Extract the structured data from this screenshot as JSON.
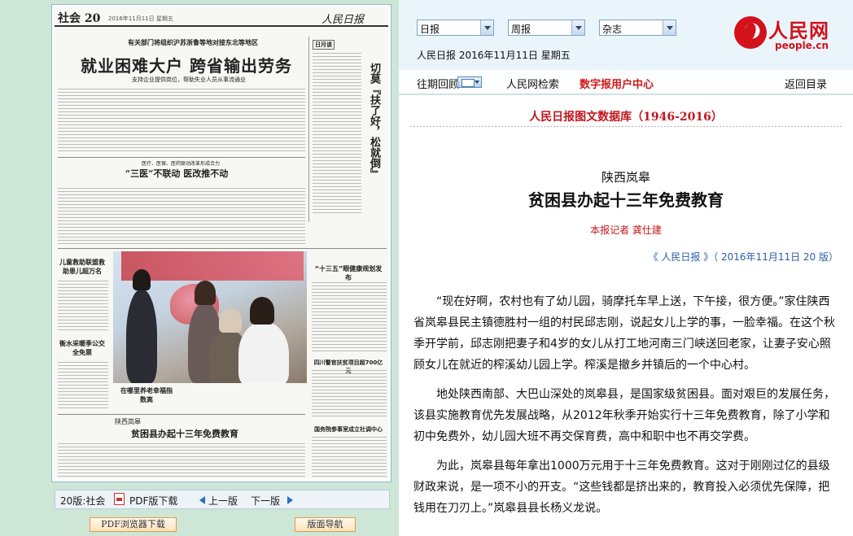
{
  "paper": {
    "section": "社会 20",
    "date": "2016年11月11日 星期五",
    "logo": "人民日报",
    "kicker": "有关部门将组织沪苏浙鲁等地对接东北等地区",
    "headline": "就业困难大户  跨省输出劳务",
    "deck": "支持企业提供岗位，帮助失业人员从事流通业",
    "side_title": "日月谈",
    "side_vertical": "切莫『扶了好，松就倒』",
    "sub_sanyi_kicker": "医疗、医保、医药联动改革形成合力",
    "sub_sanyi": "“三医”不联动  医改推不动",
    "sub_children": "儿童救助联盟救助患儿超万名",
    "sub_winter": "衡水采暖季公交全免票",
    "sub_plan": "“十三五”眼健康规划发布",
    "sub_photo_caption": "在哪里养老幸福指数高",
    "sub_fund": "四川警官扶贫项目超700亿元",
    "sub_region": "陕西岚皋",
    "sub_article": "贫困县办起十三年免费教育",
    "sub_state": "国务院参事室成立社调中心"
  },
  "page_bar": {
    "section": "20版:社会",
    "pdf": "PDF版下载",
    "prev": "上一版",
    "next": "下一版"
  },
  "buttons": {
    "pdf_browser": "PDF浏览器下载",
    "layout_nav": "版面导航"
  },
  "header": {
    "selects": [
      "日报",
      "周报",
      "杂志"
    ],
    "issue_date": "人民日报  2016年11月11日  星期五",
    "logo_cn": "人民网",
    "logo_en": "people.cn"
  },
  "nav": {
    "back_issues": "往期回顾",
    "search": "人民网检索",
    "user_center": "数字报用户中心",
    "return": "返回目录"
  },
  "article": {
    "db_title": "人民日报图文数据库（1946-2016）",
    "pre_title": "陕西岚皋",
    "title": "贫困县办起十三年免费教育",
    "byline": "本报记者  龚仕建",
    "source": "《 人民日报 》（ 2016年11月11日   20 版）",
    "paragraphs": [
      "“现在好啊，农村也有了幼儿园，骑摩托车早上送，下午接，很方便。”家住陕西省岚皋县民主镇德胜村一组的村民邱志刚，说起女儿上学的事，一脸幸福。在这个秋季开学前，邱志刚把妻子和4岁的女儿从打工地河南三门峡送回老家，让妻子安心照顾女儿在就近的榨溪幼儿园上学。榨溪是撤乡并镇后的一个中心村。",
      "地处陕西南部、大巴山深处的岚皋县，是国家级贫困县。面对艰巨的发展任务，该县实施教育优先发展战略，从2012年秋季开始实行十三年免费教育，除了小学和初中免费外，幼儿园大班不再交保育费，高中和职中也不再交学费。",
      "为此，岚皋县每年拿出1000万元用于十三年免费教育。这对于刚刚过亿的县级财政来说，是一项不小的开支。“这些钱都是挤出来的，教育投入必须优先保障，把钱用在刀刃上。”岚皋县县长杨义龙说。"
    ]
  }
}
